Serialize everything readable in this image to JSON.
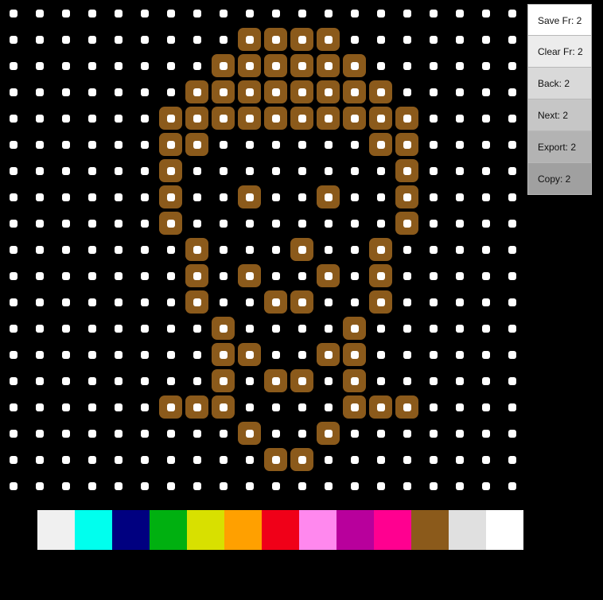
{
  "board": {
    "cols": 20,
    "rows": 19,
    "background": "#000000",
    "dot_color": "#ffffff",
    "fill_color": "#8b5a1b",
    "filled_cells": [
      [
        1,
        9
      ],
      [
        1,
        10
      ],
      [
        1,
        11
      ],
      [
        1,
        12
      ],
      [
        2,
        8
      ],
      [
        2,
        9
      ],
      [
        2,
        10
      ],
      [
        2,
        11
      ],
      [
        2,
        12
      ],
      [
        2,
        13
      ],
      [
        3,
        7
      ],
      [
        3,
        8
      ],
      [
        3,
        9
      ],
      [
        3,
        10
      ],
      [
        3,
        11
      ],
      [
        3,
        12
      ],
      [
        3,
        13
      ],
      [
        3,
        14
      ],
      [
        4,
        6
      ],
      [
        4,
        7
      ],
      [
        4,
        8
      ],
      [
        4,
        9
      ],
      [
        4,
        10
      ],
      [
        4,
        11
      ],
      [
        4,
        12
      ],
      [
        4,
        13
      ],
      [
        4,
        14
      ],
      [
        4,
        15
      ],
      [
        5,
        6
      ],
      [
        5,
        7
      ],
      [
        5,
        14
      ],
      [
        5,
        15
      ],
      [
        6,
        6
      ],
      [
        6,
        15
      ],
      [
        7,
        6
      ],
      [
        7,
        9
      ],
      [
        7,
        12
      ],
      [
        7,
        15
      ],
      [
        8,
        6
      ],
      [
        8,
        15
      ],
      [
        9,
        7
      ],
      [
        9,
        11
      ],
      [
        9,
        14
      ],
      [
        10,
        7
      ],
      [
        10,
        9
      ],
      [
        10,
        12
      ],
      [
        10,
        14
      ],
      [
        11,
        7
      ],
      [
        11,
        10
      ],
      [
        11,
        11
      ],
      [
        11,
        14
      ],
      [
        12,
        8
      ],
      [
        12,
        13
      ],
      [
        13,
        8
      ],
      [
        13,
        9
      ],
      [
        13,
        12
      ],
      [
        13,
        13
      ],
      [
        14,
        8
      ],
      [
        14,
        10
      ],
      [
        14,
        11
      ],
      [
        14,
        13
      ],
      [
        15,
        6
      ],
      [
        15,
        7
      ],
      [
        15,
        8
      ],
      [
        15,
        13
      ],
      [
        15,
        14
      ],
      [
        15,
        15
      ],
      [
        16,
        9
      ],
      [
        16,
        12
      ],
      [
        17,
        10
      ],
      [
        17,
        11
      ]
    ]
  },
  "controls": [
    {
      "label": "Save Fr: 2",
      "color": "#ffffff"
    },
    {
      "label": "Clear Fr: 2",
      "color": "#ececec"
    },
    {
      "label": "Back: 2",
      "color": "#d9d9d9"
    },
    {
      "label": "Next: 2",
      "color": "#c6c6c6"
    },
    {
      "label": "Export: 2",
      "color": "#b3b3b3"
    },
    {
      "label": "Copy: 2",
      "color": "#a0a0a0"
    }
  ],
  "palette": [
    "#f0f0f0",
    "#00ffee",
    "#000080",
    "#00b010",
    "#d8e000",
    "#ffa000",
    "#f00018",
    "#ff88ee",
    "#b8009c",
    "#ff0090",
    "#8b5a1b",
    "#e0e0e0",
    "#ffffff"
  ]
}
